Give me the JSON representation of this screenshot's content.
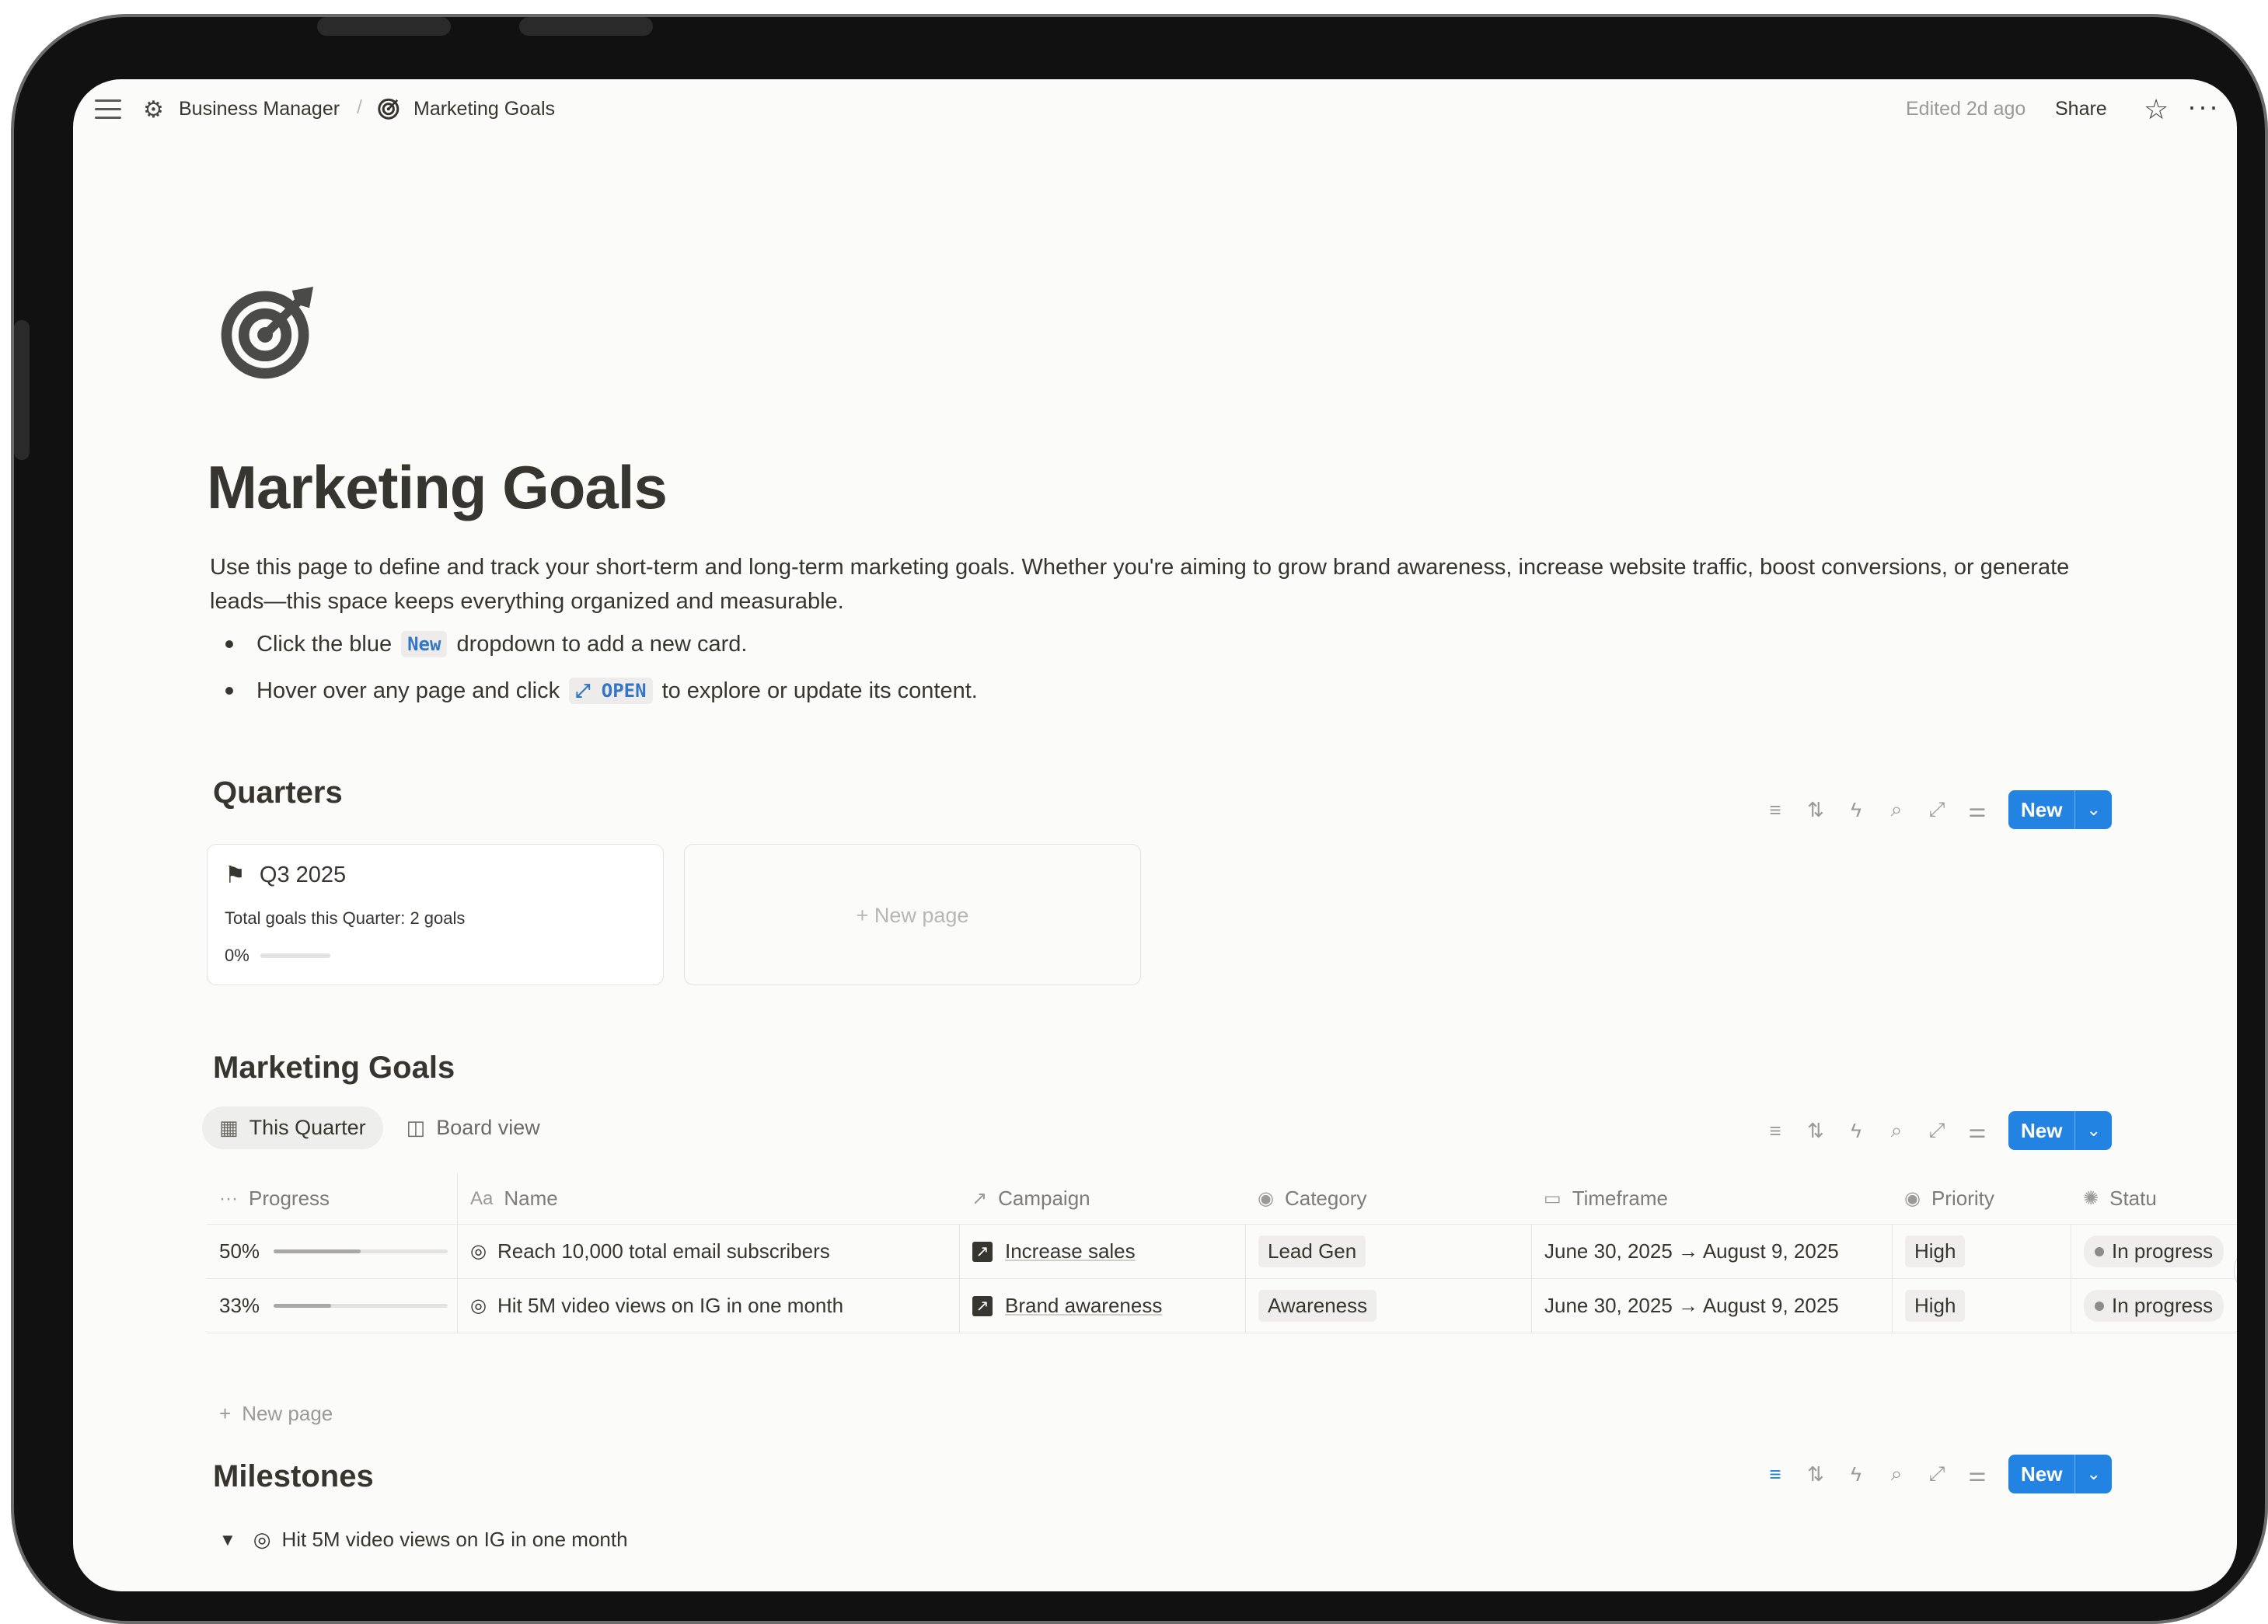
{
  "breadcrumb": {
    "workspace": "Business Manager",
    "page": "Marketing Goals"
  },
  "topbar": {
    "edited": "Edited 2d ago",
    "share": "Share"
  },
  "page": {
    "title": "Marketing Goals",
    "description": "Use this page to define and track your short-term and long-term marketing goals. Whether you're aiming to grow brand awareness, increase website traffic, boost conversions, or generate leads—this space keeps everything organized and measurable.",
    "bullet1": {
      "before": "Click the blue",
      "code": "New",
      "after": "dropdown to add a new card."
    },
    "bullet2": {
      "before": "Hover over any page and click",
      "code": "⤢ OPEN",
      "after": "to explore or update its content."
    }
  },
  "quarters": {
    "heading": "Quarters",
    "new_label": "New",
    "card": {
      "name": "Q3 2025",
      "subtitle": "Total goals this Quarter: 2 goals",
      "progress_text": "0%",
      "progress": 0
    },
    "new_page": "+ New page"
  },
  "goals": {
    "heading": "Marketing Goals",
    "new_label": "New",
    "tabs": [
      "This Quarter",
      "Board view"
    ],
    "columns": [
      "Progress",
      "Name",
      "Campaign",
      "Category",
      "Timeframe",
      "Priority",
      "Statu"
    ],
    "rows": [
      {
        "progress_text": "50%",
        "progress": 0.5,
        "name": "Reach 10,000 total email subscribers",
        "campaign": "Increase sales",
        "category": "Lead Gen",
        "timeframe": "June 30, 2025 → August 9, 2025",
        "priority": "High",
        "status": "In progress"
      },
      {
        "progress_text": "33%",
        "progress": 0.33,
        "name": "Hit 5M video views on IG in one month",
        "campaign": "Brand awareness",
        "category": "Awareness",
        "timeframe": "June 30, 2025 → August 9, 2025",
        "priority": "High",
        "status": "In progress"
      }
    ],
    "new_page": "New page"
  },
  "milestones": {
    "heading": "Milestones",
    "new_label": "New",
    "group": "Hit 5M video views on IG in one month"
  },
  "colors": {
    "accent": "#2383e2",
    "text": "#37352f",
    "muted": "#9b9a97"
  }
}
